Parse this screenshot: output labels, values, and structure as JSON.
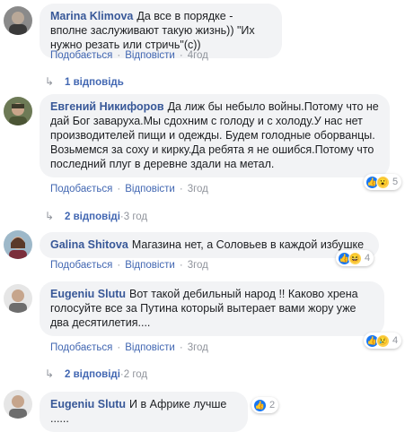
{
  "comments": [
    {
      "author": "Marina Klimova",
      "text": "Да все в порядке - вполне заслуживают такую жизнь)) \"Их нужно резать или стричь\"(с))",
      "like": "Подобається",
      "reply": "Відповісти",
      "time": "4год",
      "replies": "1 відповідь",
      "replies_time": ""
    },
    {
      "author": "Евгений Никифоров",
      "text": "Да лиж бы небыло войны.Потому что не дай Бог заваруха.Мы сдохним с голоду и с холоду.У нас нет производителей пищи и одежды. Будем голодные оборванцы. Возьмемся за соху и кирку.Да ребята я не ошибся.Потому что последний плуг в деревне здали на метал.",
      "like": "Подобається",
      "reply": "Відповісти",
      "time": "3год",
      "reactions": {
        "icons": [
          "like-icon",
          "wow-icon"
        ],
        "count": "5"
      },
      "replies": "2 відповіді",
      "replies_time": "3 год"
    },
    {
      "author": "Galina Shitova",
      "text": "Магазина нет, а Соловьев в каждой избушке",
      "like": "Подобається",
      "reply": "Відповісти",
      "time": "3год",
      "reactions": {
        "icons": [
          "like-icon",
          "haha-icon"
        ],
        "count": "4"
      }
    },
    {
      "author": "Eugeniu Slutu",
      "text": "Вот такой дебильный народ !! Каково хрена голосуйте все за Путина который вытерает вами жору уже два десятилетия....",
      "like": "Подобається",
      "reply": "Відповісти",
      "time": "3год",
      "reactions": {
        "icons": [
          "like-icon",
          "sad-icon"
        ],
        "count": "4"
      },
      "replies": "2 відповіді",
      "replies_time": "2 год"
    },
    {
      "author": "Eugeniu Slutu",
      "text": "И в Африке лучше ......",
      "reactions": {
        "icons": [
          "like-icon"
        ],
        "count": "2"
      }
    }
  ],
  "colors": {
    "link": "#385898",
    "action": "#4267b2",
    "bubble": "#f2f3f5",
    "meta": "#90949c"
  }
}
